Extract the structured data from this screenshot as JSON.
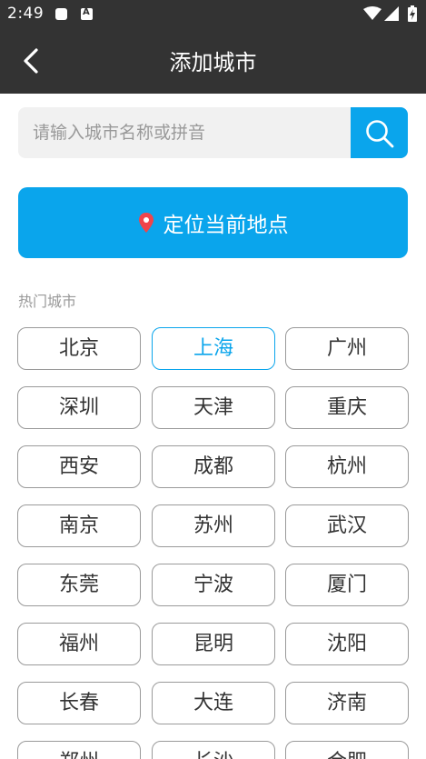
{
  "status_bar": {
    "time": "2:49"
  },
  "header": {
    "title": "添加城市"
  },
  "search": {
    "placeholder": "请输入城市名称或拼音"
  },
  "locate": {
    "label": "定位当前地点",
    "pin_color": "#f0444a"
  },
  "hot_cities": {
    "label": "热门城市",
    "selected": "上海",
    "items": [
      "北京",
      "上海",
      "广州",
      "深圳",
      "天津",
      "重庆",
      "西安",
      "成都",
      "杭州",
      "南京",
      "苏州",
      "武汉",
      "东莞",
      "宁波",
      "厦门",
      "福州",
      "昆明",
      "沈阳",
      "长春",
      "大连",
      "济南",
      "郑州",
      "长沙",
      "合肥"
    ]
  },
  "colors": {
    "accent": "#0aa5ec",
    "header_bg": "#333333"
  }
}
